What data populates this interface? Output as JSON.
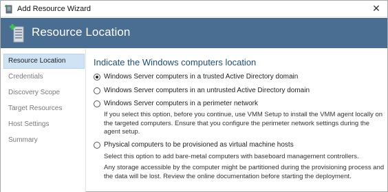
{
  "window": {
    "title": "Add Resource Wizard",
    "close_glyph": "✕"
  },
  "header": {
    "title": "Resource Location"
  },
  "sidebar": {
    "items": [
      {
        "label": "Resource Location",
        "active": true
      },
      {
        "label": "Credentials",
        "active": false
      },
      {
        "label": "Discovery Scope",
        "active": false
      },
      {
        "label": "Target Resources",
        "active": false
      },
      {
        "label": "Host Settings",
        "active": false
      },
      {
        "label": "Summary",
        "active": false
      }
    ]
  },
  "main": {
    "heading": "Indicate the Windows computers location",
    "options": [
      {
        "label": "Windows Server computers in a trusted Active Directory domain",
        "checked": true
      },
      {
        "label": "Windows Server computers in an untrusted Active Directory domain",
        "checked": false
      },
      {
        "label": "Windows Server computers in a perimeter network",
        "checked": false
      },
      {
        "label": "Physical computers to be provisioned as virtual machine hosts",
        "checked": false
      }
    ],
    "perimeter_desc": "If you select this option, before you continue, use VMM Setup to install the VMM agent locally on the targeted computers. Ensure that you configure the perimeter network settings during the agent setup.",
    "physical_desc_1": "Select this option to add bare-metal computers with baseboard management controllers.",
    "physical_desc_2": "Any storage accessible by the computer might be partitioned during the provisioning process and the data will be lost. Review the online documentation before starting the deployment."
  },
  "colors": {
    "header_bg": "#4a6d92",
    "heading_text": "#1e4e79",
    "nav_active_bg": "#cfe3f5"
  }
}
